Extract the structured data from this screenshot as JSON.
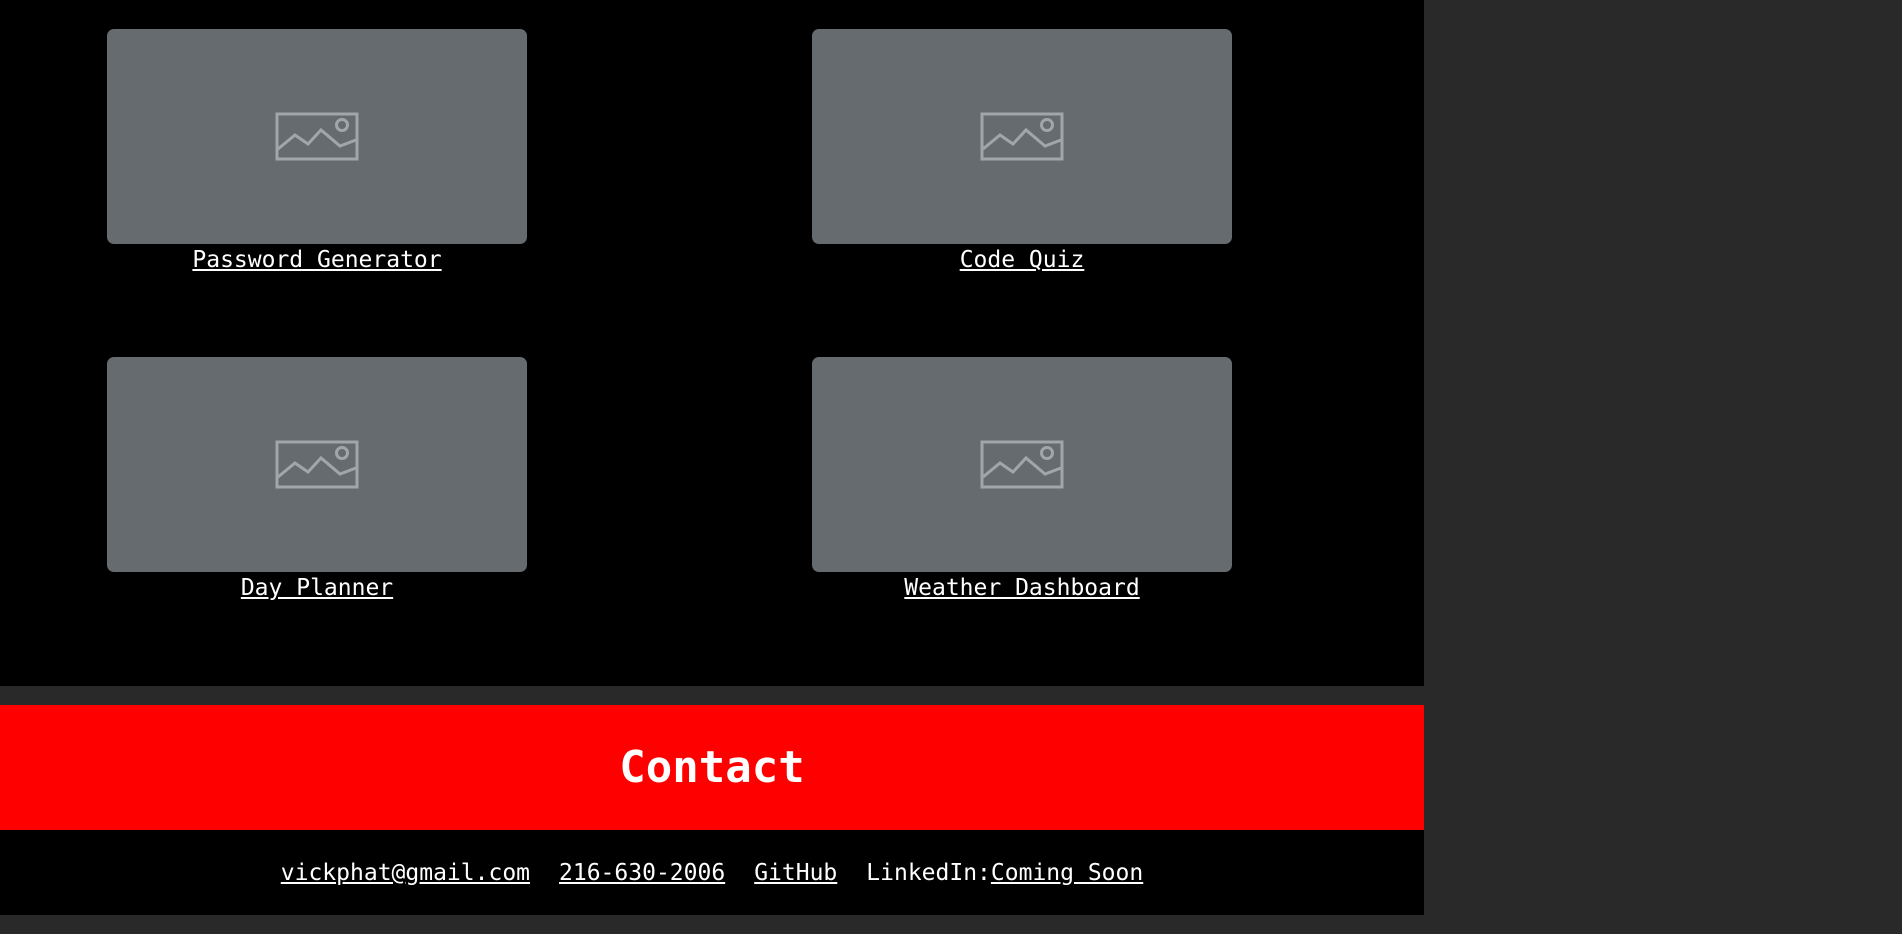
{
  "projects": [
    {
      "label": "Password Generator",
      "image_icon": "image-placeholder-icon"
    },
    {
      "label": "Code Quiz",
      "image_icon": "image-placeholder-icon"
    },
    {
      "label": "Day Planner",
      "image_icon": "image-placeholder-icon"
    },
    {
      "label": "Weather Dashboard",
      "image_icon": "image-placeholder-icon"
    }
  ],
  "contact": {
    "title": "Contact",
    "email": "vickphat@gmail.com",
    "phone": "216-630-2006",
    "github": "GitHub",
    "linkedin_label": "LinkedIn:",
    "linkedin_link": "Coming Soon"
  },
  "colors": {
    "page_background": "#292929",
    "panel_background": "#000000",
    "card_placeholder": "#666b70",
    "contact_banner": "#ff0000",
    "text": "#ffffff"
  }
}
